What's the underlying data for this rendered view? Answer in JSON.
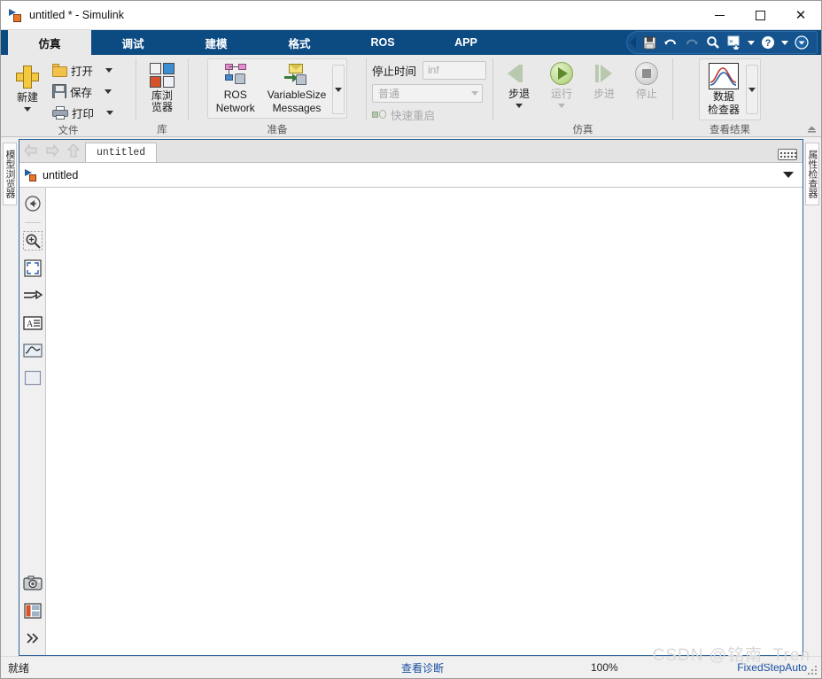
{
  "window": {
    "title": "untitled * - Simulink",
    "app_icon": "simulink-icon",
    "minimize": "–",
    "maximize": "□",
    "close": "✕"
  },
  "ribbon": {
    "tabs": [
      {
        "label": "仿真",
        "active": true
      },
      {
        "label": "调试",
        "active": false
      },
      {
        "label": "建模",
        "active": false
      },
      {
        "label": "格式",
        "active": false
      },
      {
        "label": "ROS",
        "active": false
      },
      {
        "label": "APP",
        "active": false
      }
    ],
    "quick_access": [
      {
        "name": "save-icon",
        "glyph": "💾",
        "enabled": true
      },
      {
        "name": "undo-icon",
        "glyph": "↶",
        "enabled": true
      },
      {
        "name": "redo-icon",
        "glyph": "↷",
        "enabled": false
      },
      {
        "name": "search-icon",
        "glyph": "🔍",
        "enabled": true
      },
      {
        "name": "command-favorites-icon",
        "glyph": "»",
        "enabled": true
      },
      {
        "name": "help-icon",
        "glyph": "?",
        "enabled": true
      },
      {
        "name": "more-options-icon",
        "glyph": "▼",
        "enabled": true
      }
    ],
    "groups": [
      {
        "name": "file",
        "label": "文件",
        "new_label": "新建",
        "items": [
          {
            "label": "打开",
            "icon": "folder-icon"
          },
          {
            "label": "保存",
            "icon": "save-icon"
          },
          {
            "label": "打印",
            "icon": "print-icon"
          }
        ]
      },
      {
        "name": "library",
        "label": "库",
        "button": "库浏览器"
      },
      {
        "name": "prepare",
        "label": "准备",
        "items": [
          {
            "line1": "ROS",
            "line2": "Network"
          },
          {
            "line1": "VariableSize",
            "line2": "Messages"
          }
        ]
      },
      {
        "name": "simulation-settings",
        "stop_time_label": "停止时间",
        "stop_time_value": "inf",
        "mode_value": "普通",
        "fast_restart_label": "快速重启"
      },
      {
        "name": "simulate",
        "label": "仿真",
        "items": [
          {
            "label": "步退",
            "enabled": true,
            "has_caret": true
          },
          {
            "label": "运行",
            "enabled": false,
            "has_caret": true
          },
          {
            "label": "步进",
            "enabled": false,
            "has_caret": false
          },
          {
            "label": "停止",
            "enabled": false,
            "has_caret": false
          }
        ]
      },
      {
        "name": "review-results",
        "label": "查看结果",
        "button_line1": "数据",
        "button_line2": "检查器"
      }
    ]
  },
  "panels": {
    "left_tab": "模型浏览器",
    "right_tab": "属性检查器"
  },
  "editor": {
    "nav": [
      {
        "name": "nav-back-icon",
        "enabled": false
      },
      {
        "name": "nav-forward-icon",
        "enabled": false
      },
      {
        "name": "nav-up-icon",
        "enabled": false
      }
    ],
    "document_tab": "untitled",
    "keyboard_shortcut_icon": "keyboard-icon",
    "breadcrumb_model": "untitled",
    "breadcrumb_caret": "model-hierarchy-dropdown"
  },
  "canvas_tools": [
    {
      "name": "navigate-up-icon"
    },
    {
      "name": "zoom-in-icon"
    },
    {
      "name": "fit-to-view-icon"
    },
    {
      "name": "signal-line-icon"
    },
    {
      "name": "annotation-icon"
    },
    {
      "name": "viewer-scope-icon"
    },
    {
      "name": "block-placeholder-icon"
    },
    {
      "name": "snapshot-camera-icon"
    },
    {
      "name": "legend-layout-icon"
    },
    {
      "name": "more-tools-icon"
    }
  ],
  "statusbar": {
    "ready": "就绪",
    "diagnostics": "查看诊断",
    "zoom": "100%",
    "solver": "FixedStepAuto"
  },
  "watermark": "CSDN @铭南_Tren",
  "colors": {
    "ribbon_blue": "#0c4a82",
    "ribbon_bg": "#e9e9e9",
    "link_blue": "#1a4fa0",
    "canvas": "#ffffff",
    "editor_border": "#2b6399"
  }
}
